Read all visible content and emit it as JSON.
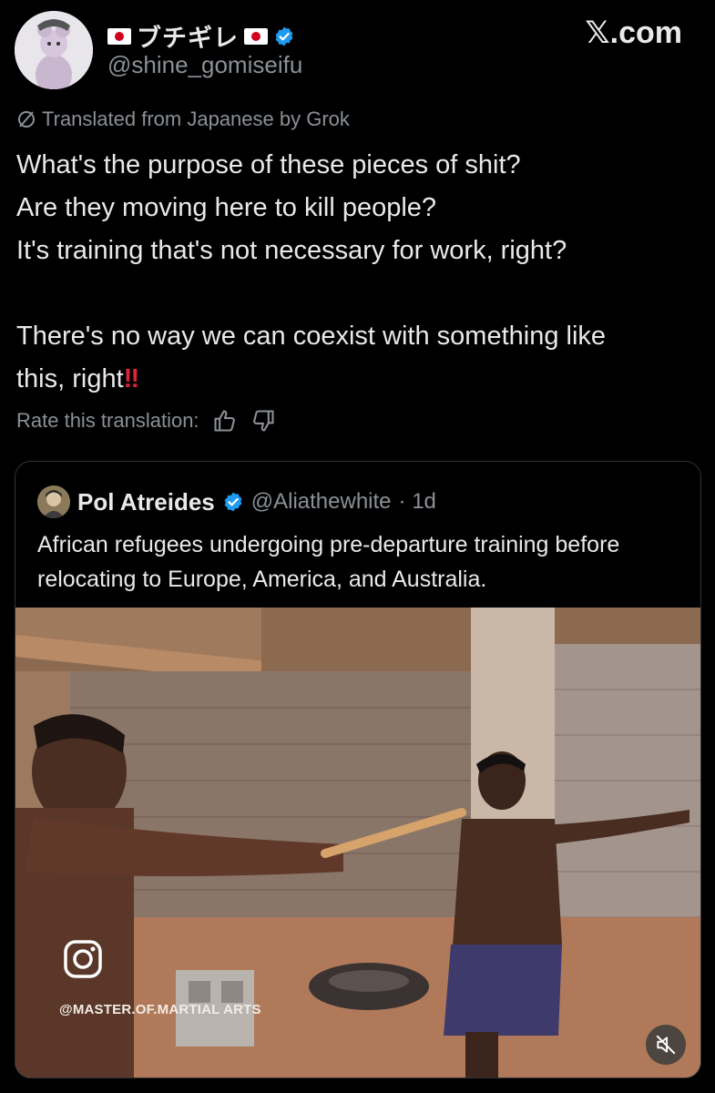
{
  "author": {
    "display_name": "ブチギレ",
    "handle": "@shine_gomiseifu",
    "verified": true
  },
  "site_brand": "𝕏.com",
  "translation_notice": "Translated from Japanese by Grok",
  "tweet": {
    "lines": [
      "What's the purpose of these pieces of shit?",
      "Are they moving here to kill people?",
      "It's training that's not necessary for work, right?",
      "There's no way we can coexist with something like",
      "this, right"
    ],
    "emphasis": "‼"
  },
  "rate_label": "Rate this translation:",
  "icons": {
    "verified": "verified-badge-icon",
    "translate": "grok-icon",
    "thumbs_up": "thumbs-up-icon",
    "thumbs_down": "thumbs-down-icon",
    "instagram": "instagram-icon",
    "mute": "mute-icon"
  },
  "quoted": {
    "name": "Pol Atreides",
    "handle": "@Aliathewhite",
    "time": "· 1d",
    "text": "African refugees undergoing pre-departure training before relocating to Europe, America, and Australia.",
    "media_watermark": "@MASTER.OF.MARTIAL ARTS"
  },
  "colors": {
    "background": "#000000",
    "text": "#e7e9ea",
    "secondary_text": "#8b9096",
    "verified_blue": "#1d9bf0",
    "border": "#2f3336",
    "emphasis_red": "#e0243a"
  }
}
